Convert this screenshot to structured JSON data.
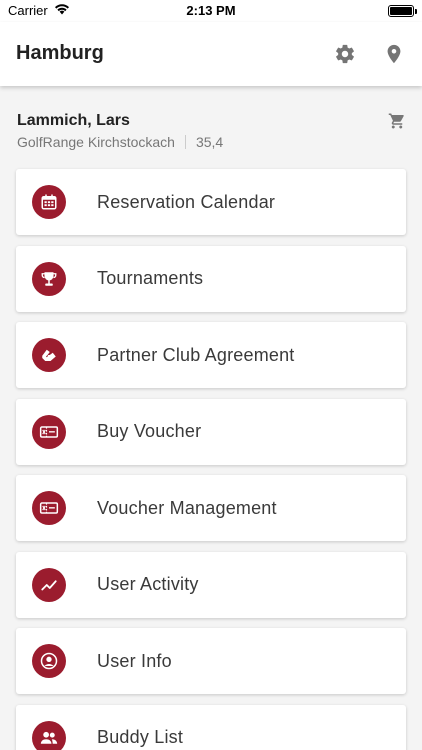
{
  "status_bar": {
    "carrier": "Carrier",
    "time": "2:13 PM"
  },
  "nav": {
    "title": "Hamburg",
    "icons": [
      "gear-icon",
      "location-pin-icon"
    ]
  },
  "user": {
    "name": "Lammich, Lars",
    "club": "GolfRange Kirchstockach",
    "handicap": "35,4",
    "cart_icon": "cart-icon"
  },
  "menu": {
    "items": [
      {
        "label": "Reservation Calendar",
        "icon": "calendar-icon"
      },
      {
        "label": "Tournaments",
        "icon": "trophy-icon"
      },
      {
        "label": "Partner Club Agreement",
        "icon": "handshake-icon"
      },
      {
        "label": "Buy Voucher",
        "icon": "voucher-icon"
      },
      {
        "label": "Voucher Management",
        "icon": "voucher-icon"
      },
      {
        "label": "User Activity",
        "icon": "activity-chart-icon"
      },
      {
        "label": "User Info",
        "icon": "user-icon"
      },
      {
        "label": "Buddy List",
        "icon": "buddies-icon"
      }
    ]
  },
  "colors": {
    "accent": "#9b1c2e",
    "nav_background": "#ffffff",
    "page_background": "#f4f4f4"
  }
}
